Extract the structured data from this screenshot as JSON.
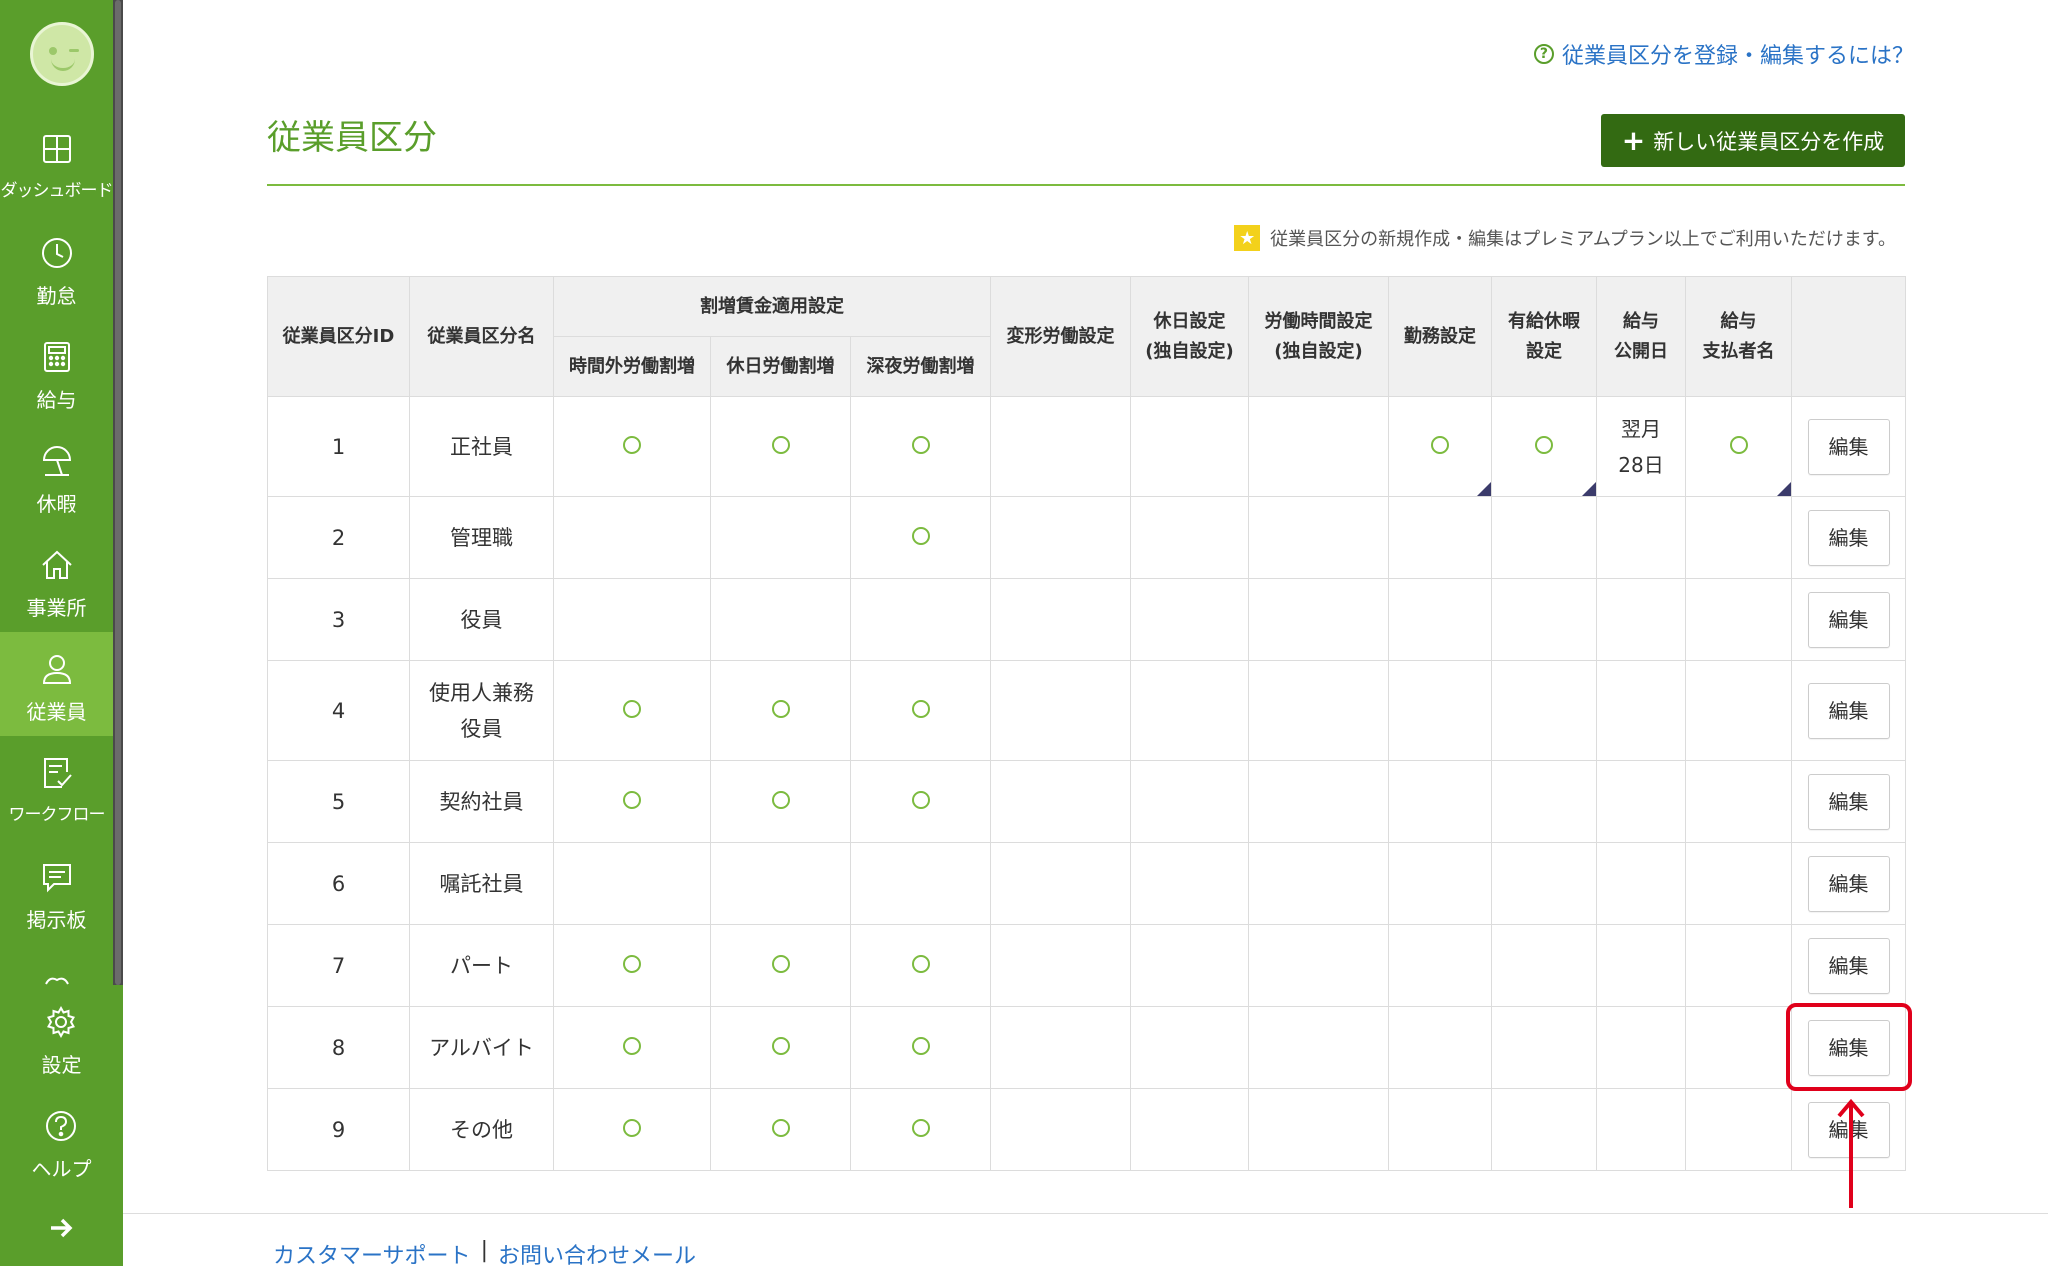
{
  "sidebar": {
    "items": [
      {
        "label": "ダッシュボード",
        "icon": "dashboard-icon"
      },
      {
        "label": "勤怠",
        "icon": "clock-icon"
      },
      {
        "label": "給与",
        "icon": "calculator-icon"
      },
      {
        "label": "休暇",
        "icon": "beach-umbrella-icon"
      },
      {
        "label": "事業所",
        "icon": "home-icon"
      },
      {
        "label": "従業員",
        "icon": "person-icon"
      },
      {
        "label": "ワークフロー",
        "icon": "workflow-icon"
      },
      {
        "label": "掲示板",
        "icon": "message-icon"
      }
    ],
    "bottom_items": [
      {
        "label": "設定",
        "icon": "gear-icon"
      },
      {
        "label": "ヘルプ",
        "icon": "help-icon"
      }
    ],
    "active_item": "従業員",
    "accent_color": "#5a9e2b"
  },
  "header": {
    "help_link": "従業員区分を登録・編集するには？",
    "title": "従業員区分",
    "new_button": "新しい従業員区分を作成",
    "premium_note": "従業員区分の新規作成・編集はプレミアムプラン以上でご利用いただけます。"
  },
  "table": {
    "headers": {
      "id": "従業員区分ID",
      "name": "従業員区分名",
      "premium_group": "割増賃金適用設定",
      "overtime": "時間外労働割増",
      "holiday_work": "休日労働割増",
      "night_work": "深夜労働割増",
      "variable_hours": "変形労働設定",
      "holiday_setting_1": "休日設定",
      "holiday_setting_2": "(独自設定)",
      "work_hours_1": "労働時間設定",
      "work_hours_2": "(独自設定)",
      "work_setting": "勤務設定",
      "paid_leave_1": "有給休暇",
      "paid_leave_2": "設定",
      "pay_publish_1": "給与",
      "pay_publish_2": "公開日",
      "payer_1": "給与",
      "payer_2": "支払者名"
    },
    "edit_label": "編集",
    "rows": [
      {
        "id": "1",
        "name": [
          "正社員"
        ],
        "overtime": true,
        "holiday": true,
        "night": true,
        "work_setting": true,
        "paid_leave": true,
        "pay_publish": [
          "翌月",
          "28日"
        ],
        "payer": true
      },
      {
        "id": "2",
        "name": [
          "管理職"
        ],
        "overtime": false,
        "holiday": false,
        "night": true
      },
      {
        "id": "3",
        "name": [
          "役員"
        ],
        "overtime": false,
        "holiday": false,
        "night": false
      },
      {
        "id": "4",
        "name": [
          "使用人兼務",
          "役員"
        ],
        "overtime": true,
        "holiday": true,
        "night": true
      },
      {
        "id": "5",
        "name": [
          "契約社員"
        ],
        "overtime": true,
        "holiday": true,
        "night": true
      },
      {
        "id": "6",
        "name": [
          "嘱託社員"
        ],
        "overtime": false,
        "holiday": false,
        "night": false
      },
      {
        "id": "7",
        "name": [
          "パート"
        ],
        "overtime": true,
        "holiday": true,
        "night": true
      },
      {
        "id": "8",
        "name": [
          "アルバイト"
        ],
        "overtime": true,
        "holiday": true,
        "night": true
      },
      {
        "id": "9",
        "name": [
          "その他"
        ],
        "overtime": true,
        "holiday": true,
        "night": true
      }
    ]
  },
  "annotation": {
    "highlight_color": "#e0001b",
    "highlight_row": "8"
  },
  "footer": {
    "support_link": "カスタマーサポート",
    "separator": "|",
    "contact_link": "お問い合わせメール"
  }
}
